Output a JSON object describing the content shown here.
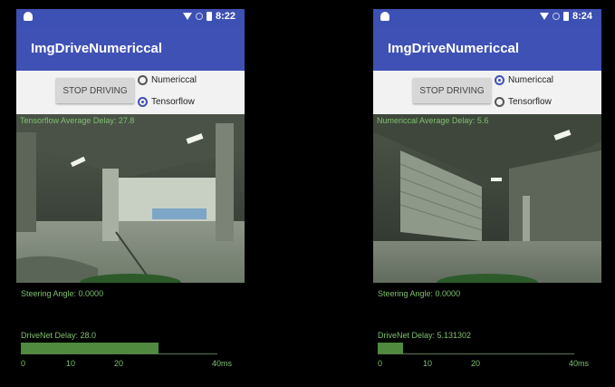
{
  "left": {
    "status_time": "8:22",
    "app_title": "ImgDriveNumericcal",
    "stop_button": "STOP DRIVING",
    "radio_options": [
      "Numericcal",
      "Tensorflow"
    ],
    "selected_option": "Tensorflow",
    "camera_caption": "Tensorflow Average Delay: 27.8",
    "steering_text": "Steering Angle: 0.0000",
    "delay_text": "DriveNet Delay: 28.0",
    "delay_fraction": 0.7,
    "axis_ticks": [
      "0",
      "10",
      "20",
      "40ms"
    ]
  },
  "right": {
    "status_time": "8:24",
    "app_title": "ImgDriveNumericcal",
    "stop_button": "STOP DRIVING",
    "radio_options": [
      "Numericcal",
      "Tensorflow"
    ],
    "selected_option": "Numericcal",
    "camera_caption": "Numericcal Average Delay: 5.6",
    "steering_text": "Steering Angle: 0.0000",
    "delay_text": "DriveNet Delay: 5.131302",
    "delay_fraction": 0.13,
    "axis_ticks": [
      "0",
      "10",
      "20",
      "40ms"
    ]
  },
  "colors": {
    "appbar": "#3f51b5",
    "accent_text": "#7fc06e",
    "bar": "#4f8a3e"
  }
}
